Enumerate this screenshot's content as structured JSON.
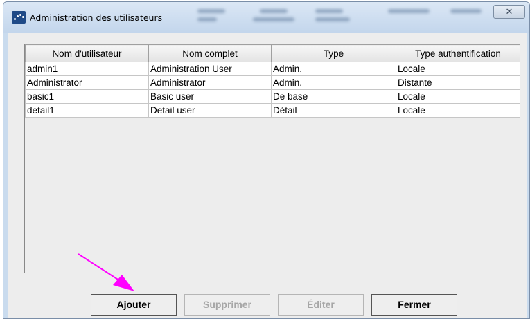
{
  "window": {
    "title": "Administration des utilisateurs",
    "close_symbol": "✕"
  },
  "table": {
    "columns": [
      "Nom d'utilisateur",
      "Nom complet",
      "Type",
      "Type authentification"
    ],
    "rows": [
      [
        "admin1",
        "Administration User",
        "Admin.",
        "Locale"
      ],
      [
        "Administrator",
        "Administrator",
        "Admin.",
        "Distante"
      ],
      [
        "basic1",
        "Basic user",
        "De base",
        "Locale"
      ],
      [
        "detail1",
        "Detail user",
        "Détail",
        "Locale"
      ]
    ]
  },
  "buttons": {
    "add": "Ajouter",
    "delete": "Supprimer",
    "edit": "Éditer",
    "close": "Fermer"
  },
  "annotation": {
    "arrow_color": "#ff00ff",
    "arrow_target": "add-button"
  }
}
